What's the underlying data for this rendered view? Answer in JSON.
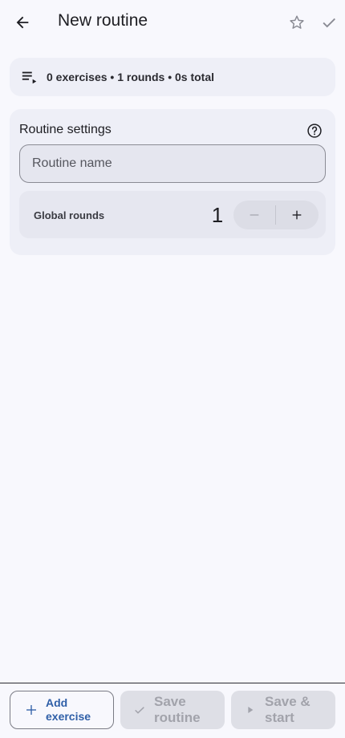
{
  "appbar": {
    "title": "New routine",
    "icons": {
      "back": "arrow-back-icon",
      "favorite": "star-outline-icon",
      "confirm": "check-icon"
    }
  },
  "summary": {
    "icon": "playlist-play-icon",
    "text": "0 exercises • 1 rounds • 0s total"
  },
  "settings": {
    "heading": "Routine settings",
    "help_icon": "help-circle-icon",
    "name_input": {
      "placeholder": "Routine name",
      "value": ""
    },
    "global_rounds": {
      "label": "Global rounds",
      "value": "1",
      "decrement_icon": "minus-icon",
      "increment_icon": "plus-icon"
    }
  },
  "bottom_actions": {
    "add_exercise": {
      "line1": "Add",
      "line2": "exercise",
      "icon": "plus-icon"
    },
    "save_routine": {
      "line1": "Save",
      "line2": "routine",
      "icon": "check-icon",
      "disabled": true
    },
    "save_start": {
      "line1": "Save &",
      "line2": "start",
      "icon": "play-icon",
      "disabled": true
    }
  },
  "colors": {
    "background": "#f8f8fd",
    "card": "#eeeff7",
    "accent": "#2f5fa8",
    "disabled_text": "#a2a3ab"
  }
}
